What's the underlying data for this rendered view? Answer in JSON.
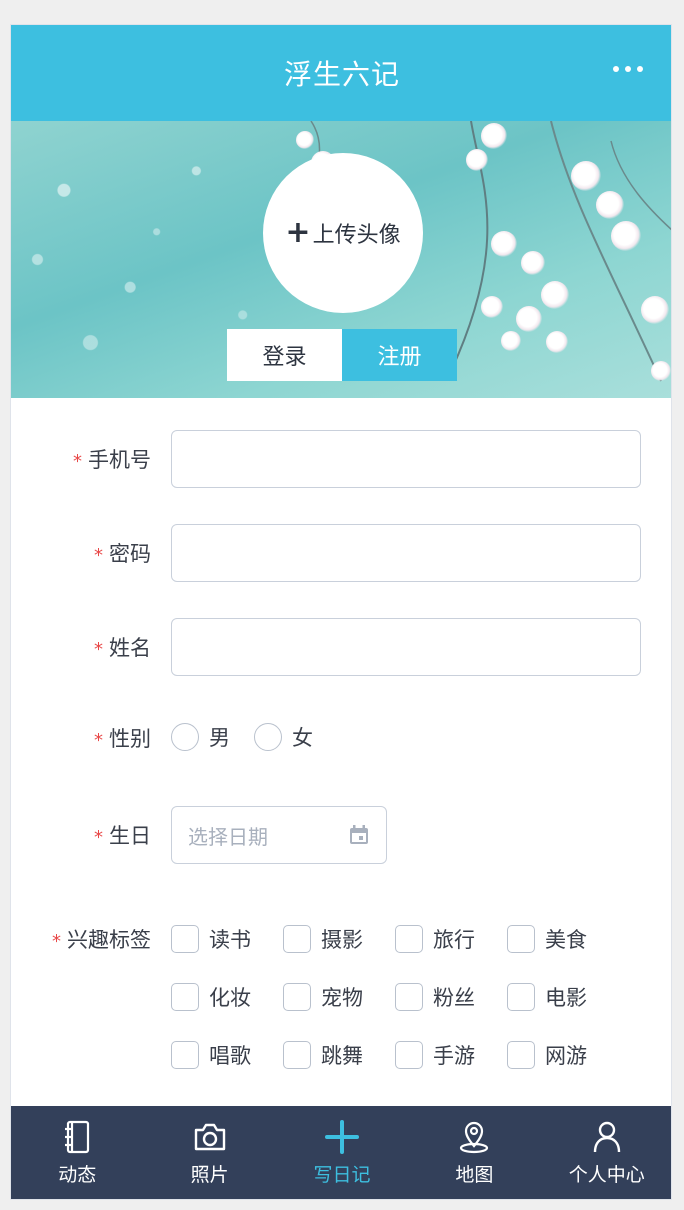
{
  "header": {
    "title": "浮生六记",
    "more_icon": "more-dots-icon"
  },
  "banner": {
    "avatar_plus": "+",
    "avatar_label": "上传头像",
    "tabs": [
      {
        "label": "登录",
        "active": false
      },
      {
        "label": "注册",
        "active": true
      }
    ]
  },
  "form": {
    "required_mark": "*",
    "phone": {
      "label": "手机号",
      "value": ""
    },
    "password": {
      "label": "密码",
      "value": ""
    },
    "name": {
      "label": "姓名",
      "value": ""
    },
    "gender": {
      "label": "性别",
      "options": [
        "男",
        "女"
      ]
    },
    "birthday": {
      "label": "生日",
      "placeholder": "选择日期",
      "icon": "calendar-icon"
    },
    "interests": {
      "label": "兴趣标签",
      "options": [
        "读书",
        "摄影",
        "旅行",
        "美食",
        "化妆",
        "宠物",
        "粉丝",
        "电影",
        "唱歌",
        "跳舞",
        "手游",
        "网游"
      ]
    }
  },
  "tabbar": {
    "items": [
      {
        "label": "动态",
        "icon": "notebook-icon",
        "active": false
      },
      {
        "label": "照片",
        "icon": "camera-icon",
        "active": false
      },
      {
        "label": "写日记",
        "icon": "plus-icon",
        "active": true
      },
      {
        "label": "地图",
        "icon": "map-pin-icon",
        "active": false
      },
      {
        "label": "个人中心",
        "icon": "user-icon",
        "active": false
      }
    ]
  },
  "colors": {
    "primary": "#3dbfe0",
    "tabbar_bg": "#33405a",
    "required": "#e84747"
  }
}
